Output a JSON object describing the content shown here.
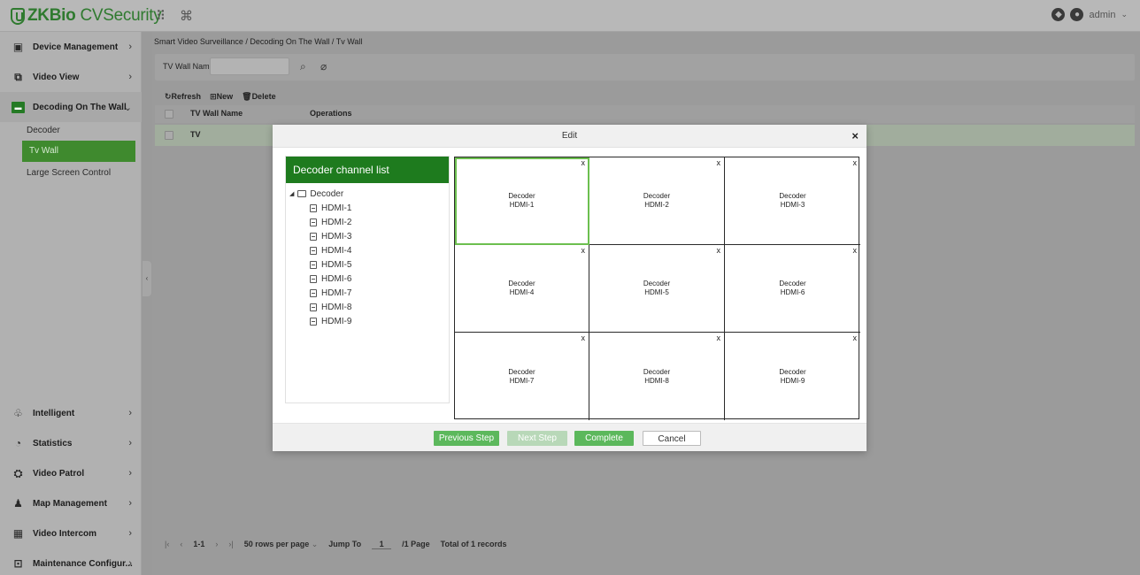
{
  "header": {
    "logo": "ZKBio",
    "logo_rest": "CVSecurity",
    "user": "admin"
  },
  "sidebar": {
    "items": [
      {
        "label": "Device Management",
        "icon": "device-icon"
      },
      {
        "label": "Video View",
        "icon": "video-icon"
      },
      {
        "label": "Decoding On The Wall",
        "icon": "monitor-icon"
      }
    ],
    "subitems": [
      {
        "label": "Decoder"
      },
      {
        "label": "Tv Wall"
      },
      {
        "label": "Large Screen Control"
      }
    ],
    "bottom_items": [
      {
        "label": "Intelligent",
        "icon": "intelligent-icon"
      },
      {
        "label": "Statistics",
        "icon": "statistics-icon"
      },
      {
        "label": "Video Patrol",
        "icon": "patrol-icon"
      },
      {
        "label": "Map Management",
        "icon": "map-icon"
      },
      {
        "label": "Video Intercom",
        "icon": "intercom-icon"
      },
      {
        "label": "Maintenance Configur...",
        "icon": "maintenance-icon"
      }
    ]
  },
  "main": {
    "breadcrumb": "Smart Video Surveillance / Decoding On The Wall / Tv Wall",
    "filter_label": "TV Wall Name",
    "toolbar": {
      "refresh": "Refresh",
      "new": "New",
      "delete": "Delete"
    },
    "table": {
      "headers": [
        "TV Wall Name",
        "Operations"
      ],
      "rows": [
        {
          "name": "TV"
        }
      ]
    },
    "pager": {
      "range": "1-1",
      "rows_per_page": "50 rows per page",
      "jump_to": "Jump To",
      "page_value": "1",
      "page_total": "/1 Page",
      "total": "Total of 1 records"
    }
  },
  "modal": {
    "title": "Edit",
    "panel_title": "Decoder channel list",
    "tree_root": "Decoder",
    "channels": [
      "HDMI-1",
      "HDMI-2",
      "HDMI-3",
      "HDMI-4",
      "HDMI-5",
      "HDMI-6",
      "HDMI-7",
      "HDMI-8",
      "HDMI-9"
    ],
    "grid_cells": [
      {
        "line1": "Decoder",
        "line2": "HDMI-1",
        "close": "x"
      },
      {
        "line1": "Decoder",
        "line2": "HDMI-2",
        "close": "x"
      },
      {
        "line1": "Decoder",
        "line2": "HDMI-3",
        "close": "x"
      },
      {
        "line1": "Decoder",
        "line2": "HDMI-4",
        "close": "x"
      },
      {
        "line1": "Decoder",
        "line2": "HDMI-5",
        "close": "x"
      },
      {
        "line1": "Decoder",
        "line2": "HDMI-6",
        "close": "x"
      },
      {
        "line1": "Decoder",
        "line2": "HDMI-7",
        "close": "x"
      },
      {
        "line1": "Decoder",
        "line2": "HDMI-8",
        "close": "x"
      },
      {
        "line1": "Decoder",
        "line2": "HDMI-9",
        "close": "x"
      }
    ],
    "buttons": {
      "previous": "Previous Step",
      "next": "Next Step",
      "complete": "Complete",
      "cancel": "Cancel"
    }
  },
  "colors": {
    "brand_green": "#1e7b1e",
    "button_green": "#5cb85c",
    "selected_outline": "#6cbf4f"
  }
}
